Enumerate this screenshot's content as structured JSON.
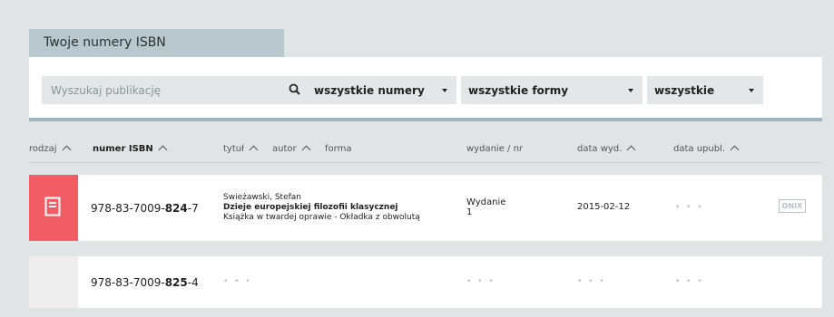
{
  "tab": {
    "title": "Twoje numery ISBN"
  },
  "filters": {
    "search_placeholder": "Wyszukaj publikację",
    "numbers_select": "wszystkie numery",
    "forms_select": "wszystkie formy",
    "status_select": "wszystkie"
  },
  "columns": {
    "rodzaj": "rodzaj",
    "isbn": "numer ISBN",
    "tytul": "tytuł",
    "autor": "autor",
    "forma": "forma",
    "wydanie": "wydanie / nr",
    "data_wyd": "data wyd.",
    "data_upubl": "data upubl."
  },
  "rows": [
    {
      "type_icon": "book-icon",
      "isbn_prefix": "978-83-7009-",
      "isbn_bold": "824",
      "isbn_suffix": "-7",
      "author": "Swieżawski, Stefan",
      "title": "Dzieje europejskiej filozofii klasycznej",
      "form": "Książka w twardej oprawie - Okładka z obwolutą",
      "edition_label": "Wydanie",
      "edition_number": "1",
      "pub_date": "2015-02-12",
      "publ_date": "• • •",
      "onix": "ONIX"
    },
    {
      "isbn_prefix": "978-83-7009-",
      "isbn_bold": "825",
      "isbn_suffix": "-4",
      "title_placeholder": "• • •",
      "edition_placeholder": "• • •",
      "pub_date_placeholder": "• • •",
      "publ_date_placeholder": "• • •"
    }
  ],
  "colors": {
    "accent": "#f25c63",
    "tab": "#b7c9cf",
    "background": "#dfe4e7"
  }
}
